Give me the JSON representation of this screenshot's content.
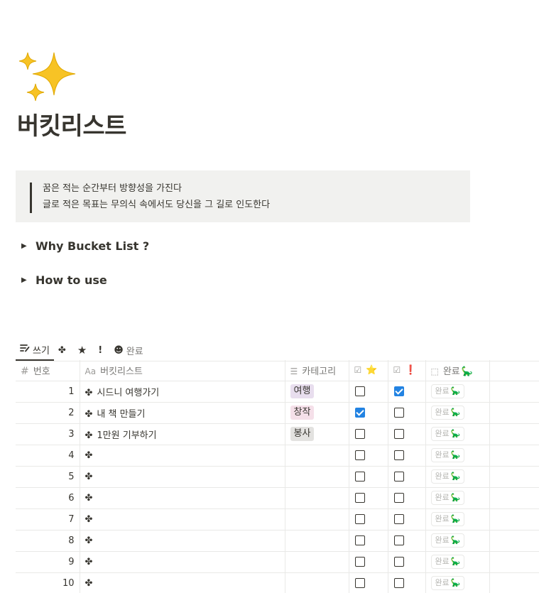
{
  "page": {
    "title": "버킷리스트",
    "icon": "sparkles-icon"
  },
  "quote": {
    "line1": "꿈은 적는 순간부터 방향성을 가진다",
    "line2": "글로 적은 목표는 무의식 속에서도 당신을 그 길로 인도한다"
  },
  "toggles": [
    {
      "label": "Why Bucket List ?"
    },
    {
      "label": "How to use"
    }
  ],
  "tabs": [
    {
      "label": "쓰기",
      "icon": "edit-list-icon",
      "active": true
    },
    {
      "label": "",
      "icon": "clover-icon",
      "active": false
    },
    {
      "label": "",
      "icon": "star-icon",
      "active": false
    },
    {
      "label": "",
      "icon": "exclamation-icon",
      "active": false
    },
    {
      "label": "완료",
      "icon": "smiley-icon",
      "active": false
    }
  ],
  "columns": {
    "number": "번호",
    "name": "버킷리스트",
    "category": "카테고리",
    "star": "⭐",
    "urgent": "❗",
    "done": "완료"
  },
  "column_icons": {
    "number": "#",
    "name": "Aa",
    "category": "list-icon",
    "star": "checkbox-icon",
    "urgent": "checkbox-icon",
    "done": "button-icon"
  },
  "rows": [
    {
      "num": "1",
      "name": "시드니 여행가기",
      "category": "여행",
      "cat_bg": "#e8deee",
      "star": false,
      "urgent": true,
      "done_label": "완료"
    },
    {
      "num": "2",
      "name": "내 책 만들기",
      "category": "창작",
      "cat_bg": "#f5e0e9",
      "star": true,
      "urgent": false,
      "done_label": "완료"
    },
    {
      "num": "3",
      "name": "1만원 기부하기",
      "category": "봉사",
      "cat_bg": "#e3e2e0",
      "star": false,
      "urgent": false,
      "done_label": "완료"
    },
    {
      "num": "4",
      "name": "",
      "category": "",
      "cat_bg": "",
      "star": false,
      "urgent": false,
      "done_label": "완료"
    },
    {
      "num": "5",
      "name": "",
      "category": "",
      "cat_bg": "",
      "star": false,
      "urgent": false,
      "done_label": "완료"
    },
    {
      "num": "6",
      "name": "",
      "category": "",
      "cat_bg": "",
      "star": false,
      "urgent": false,
      "done_label": "완료"
    },
    {
      "num": "7",
      "name": "",
      "category": "",
      "cat_bg": "",
      "star": false,
      "urgent": false,
      "done_label": "완료"
    },
    {
      "num": "8",
      "name": "",
      "category": "",
      "cat_bg": "",
      "star": false,
      "urgent": false,
      "done_label": "완료"
    },
    {
      "num": "9",
      "name": "",
      "category": "",
      "cat_bg": "",
      "star": false,
      "urgent": false,
      "done_label": "완료"
    },
    {
      "num": "10",
      "name": "",
      "category": "",
      "cat_bg": "",
      "star": false,
      "urgent": false,
      "done_label": "완료"
    }
  ],
  "colors": {
    "text": "#37352f",
    "muted": "#787774",
    "quote_bg": "#f1f1ef",
    "checkbox_on": "#2383e2"
  }
}
